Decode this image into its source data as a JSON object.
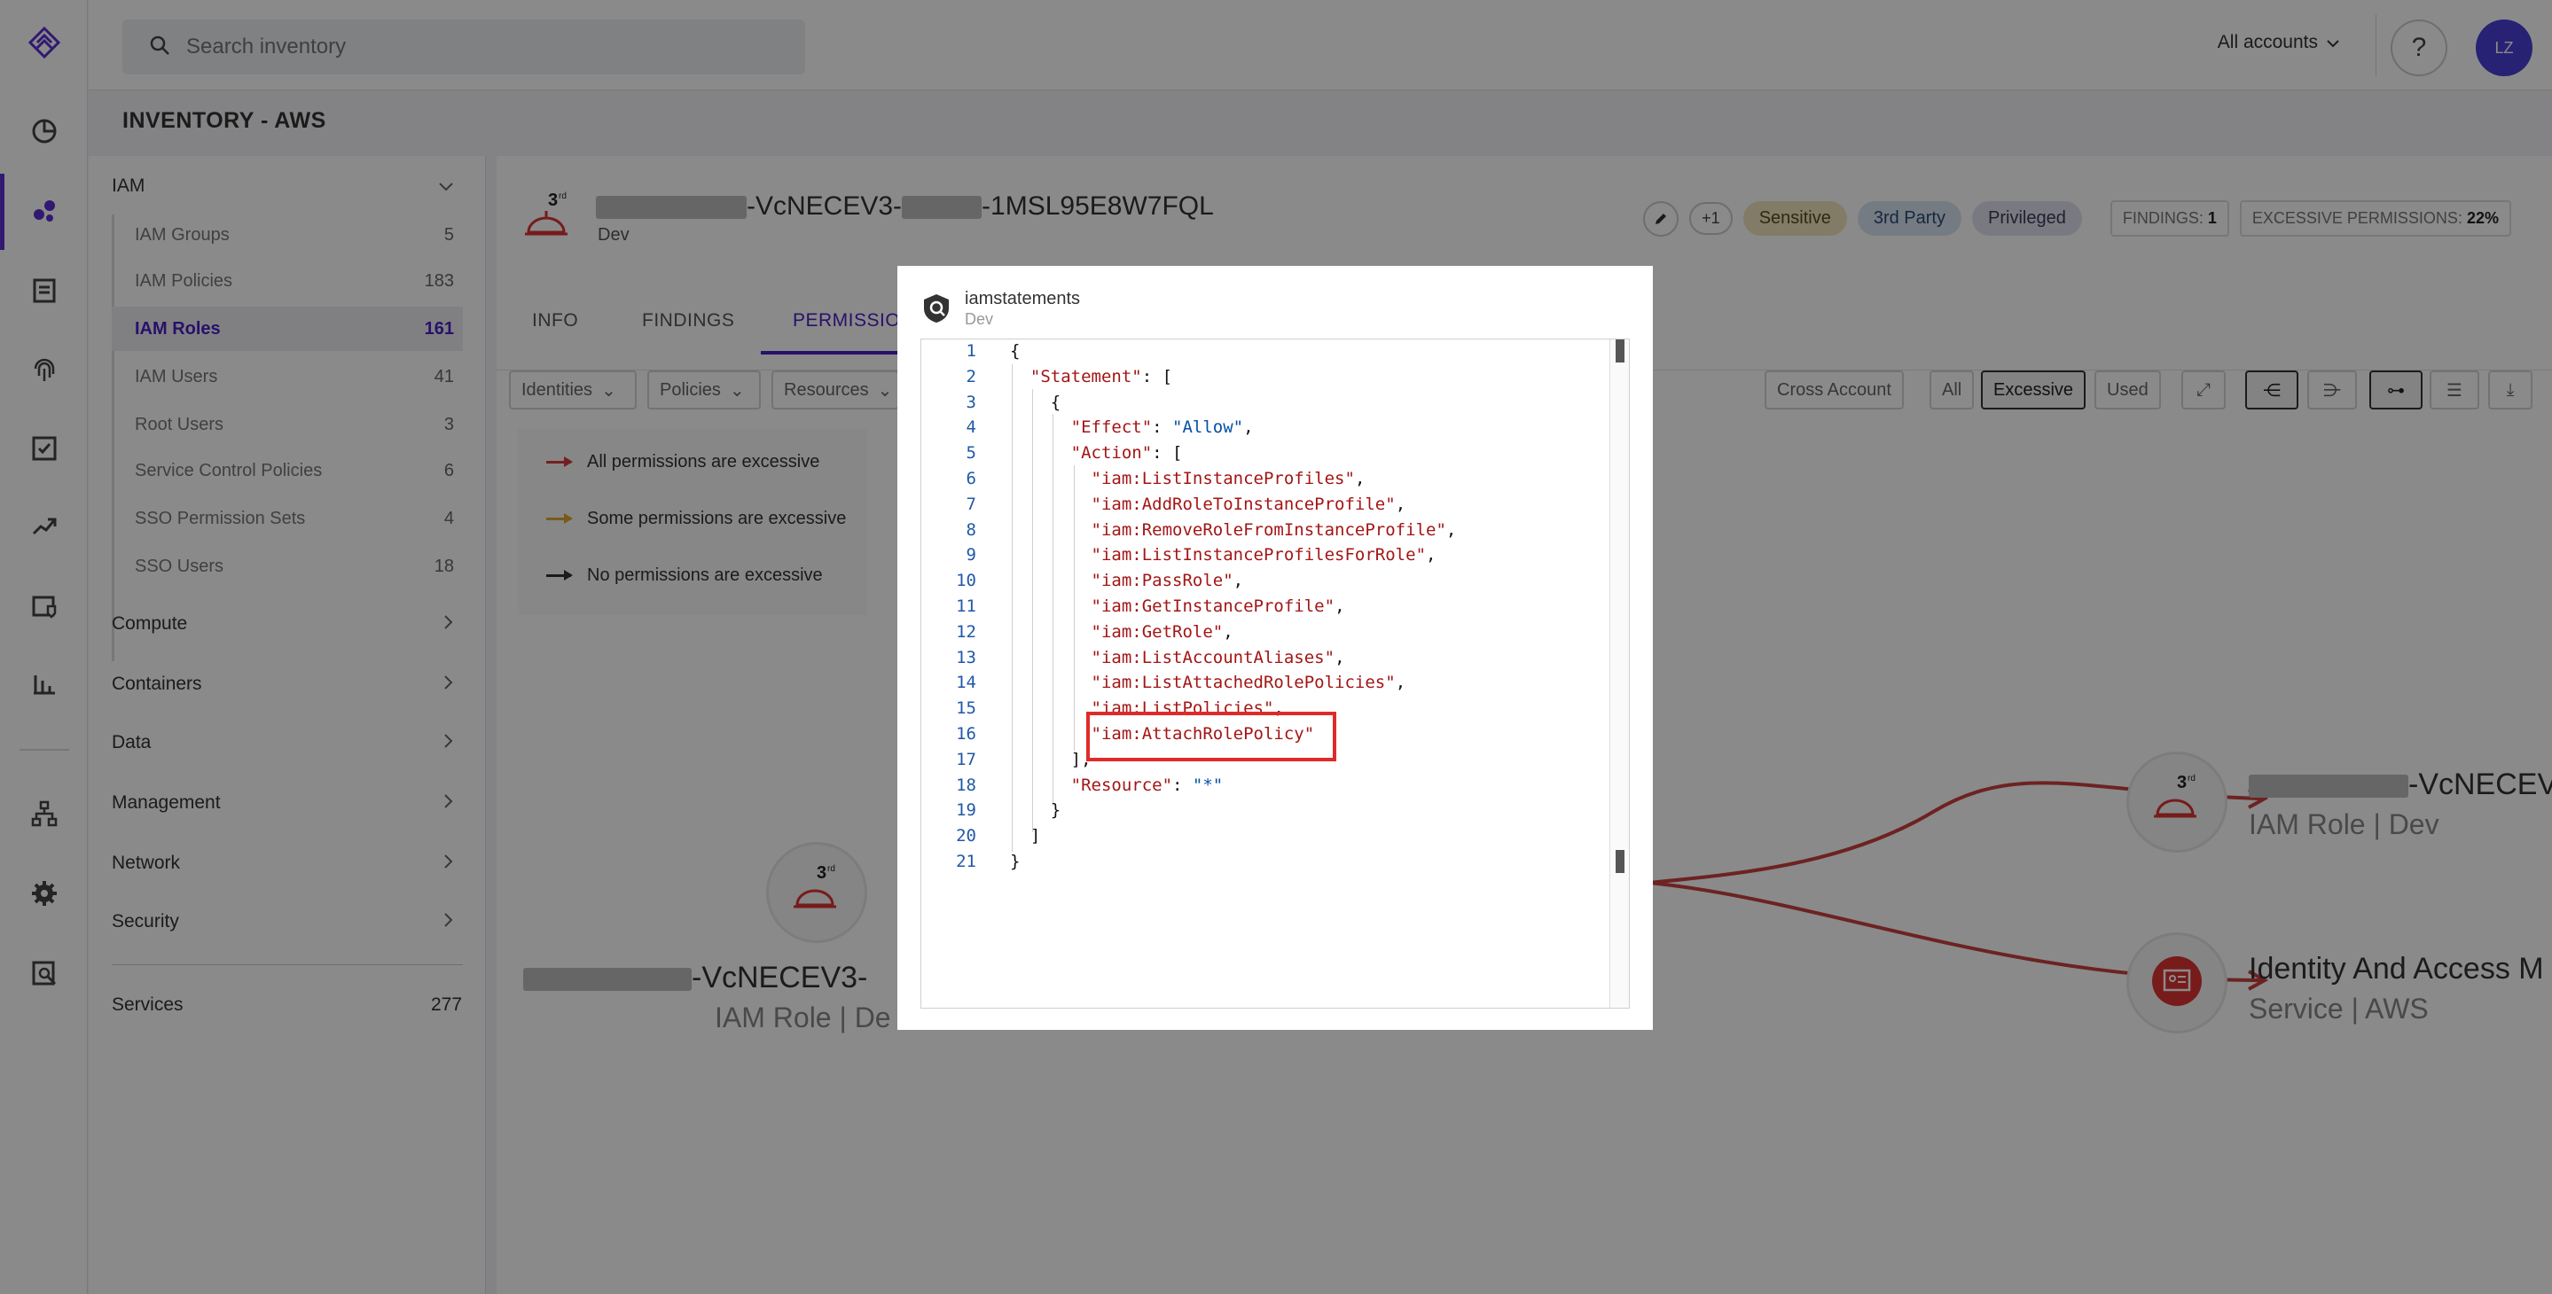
{
  "search": {
    "placeholder": "Search inventory"
  },
  "header": {
    "accounts": "All accounts",
    "help": "?",
    "avatar": "LZ"
  },
  "page": {
    "title": "INVENTORY - AWS"
  },
  "categories": {
    "iam": {
      "label": "IAM",
      "items": [
        {
          "label": "IAM Groups",
          "count": "5"
        },
        {
          "label": "IAM Policies",
          "count": "183"
        },
        {
          "label": "IAM Roles",
          "count": "161"
        },
        {
          "label": "IAM Users",
          "count": "41"
        },
        {
          "label": "Root Users",
          "count": "3"
        },
        {
          "label": "Service Control Policies",
          "count": "6"
        },
        {
          "label": "SSO Permission Sets",
          "count": "4"
        },
        {
          "label": "SSO Users",
          "count": "18"
        }
      ]
    },
    "others": [
      "Compute",
      "Containers",
      "Data",
      "Management",
      "Network",
      "Security"
    ],
    "services": {
      "label": "Services",
      "count": "277"
    }
  },
  "resource": {
    "name_suffix": "-VcNECEV3-",
    "name_tail": "-1MSL95E8W7FQL",
    "env": "Dev",
    "third_sup": "rd",
    "plus": "+1",
    "tags": [
      "Sensitive",
      "3rd Party",
      "Privileged"
    ],
    "findings_label": "FINDINGS:",
    "findings_value": "1",
    "excessive_label": "EXCESSIVE PERMISSIONS:",
    "excessive_value": "22%"
  },
  "tabs": [
    "INFO",
    "FINDINGS",
    "PERMISSIONS"
  ],
  "filters": {
    "dropdowns": [
      "Identities",
      "Policies",
      "Resources"
    ],
    "cross_account": "Cross Account",
    "scope": [
      "All",
      "Excessive",
      "Used"
    ]
  },
  "legend": [
    {
      "label": "All permissions are excessive",
      "color": "#d63a3a"
    },
    {
      "label": "Some permissions are excessive",
      "color": "#e2a92a"
    },
    {
      "label": "No permissions are excessive",
      "color": "#333333"
    }
  ],
  "graph": {
    "left_node": {
      "name": "-VcNECEV3-",
      "sub": "IAM Role | De"
    },
    "right_node_1": {
      "name": "-VcNECEV",
      "sub": "IAM Role | Dev"
    },
    "right_node_2": {
      "name": "Identity And Access M",
      "sub": "Service | AWS"
    }
  },
  "modal": {
    "title": "iamstatements",
    "subtitle": "Dev",
    "lines": [
      "{",
      "  \"Statement\": [",
      "    {",
      "      \"Effect\": \"Allow\",",
      "      \"Action\": [",
      "        \"iam:ListInstanceProfiles\",",
      "        \"iam:AddRoleToInstanceProfile\",",
      "        \"iam:RemoveRoleFromInstanceProfile\",",
      "        \"iam:ListInstanceProfilesForRole\",",
      "        \"iam:PassRole\",",
      "        \"iam:GetInstanceProfile\",",
      "        \"iam:GetRole\",",
      "        \"iam:ListAccountAliases\",",
      "        \"iam:ListAttachedRolePolicies\",",
      "        \"iam:ListPolicies\",",
      "        \"iam:AttachRolePolicy\"",
      "      ],",
      "      \"Resource\": \"*\"",
      "    }",
      "  ]",
      "}"
    ],
    "line_numbers": [
      "1",
      "2",
      "3",
      "4",
      "5",
      "6",
      "7",
      "8",
      "9",
      "10",
      "11",
      "12",
      "13",
      "14",
      "15",
      "16",
      "17",
      "18",
      "19",
      "20",
      "21"
    ]
  },
  "colors": {
    "accent": "#4b20c4",
    "highlight": "#e02a2a",
    "edge": "#c94040"
  }
}
